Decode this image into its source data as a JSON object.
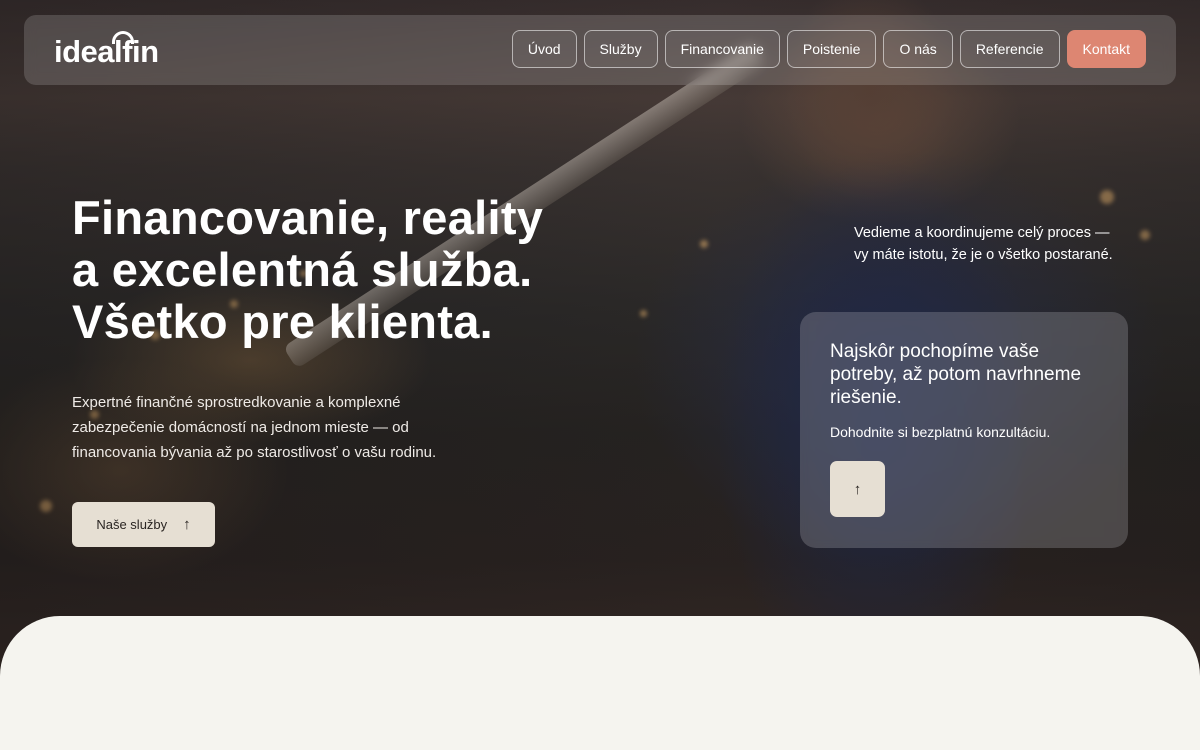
{
  "header": {
    "logo": "idealfin",
    "nav": [
      {
        "label": "Úvod"
      },
      {
        "label": "Služby"
      },
      {
        "label": "Financovanie"
      },
      {
        "label": "Poistenie"
      },
      {
        "label": "O nás"
      },
      {
        "label": "Referencie"
      },
      {
        "label": "Kontakt"
      }
    ]
  },
  "hero": {
    "headline_1": "Financovanie, reality",
    "headline_2": "a excelentná služba.",
    "headline_3": "Všetko pre klienta.",
    "intro": "Expertné finančné sprostredkovanie a komplexné zabezpečenie domácností na jednom mieste — od financovania bývania až po starostlivosť o vašu rodinu.",
    "cta_label": "Naše služby",
    "cta_icon": "arrow-up-icon",
    "side_text": "Vedieme a koordinujeme celý proces — vy máte istotu, že je o všetko postarané."
  },
  "card": {
    "title": "Najskôr pochopíme vaše potreby, až potom navrhneme riešenie.",
    "subtitle": "Dohodnite si bezplatnú konzultáciu.",
    "button_icon": "arrow-up-icon"
  },
  "colors": {
    "accent": "#dd8672",
    "button_bg": "#e6dfd3",
    "page_bg": "#f5f4ef"
  }
}
